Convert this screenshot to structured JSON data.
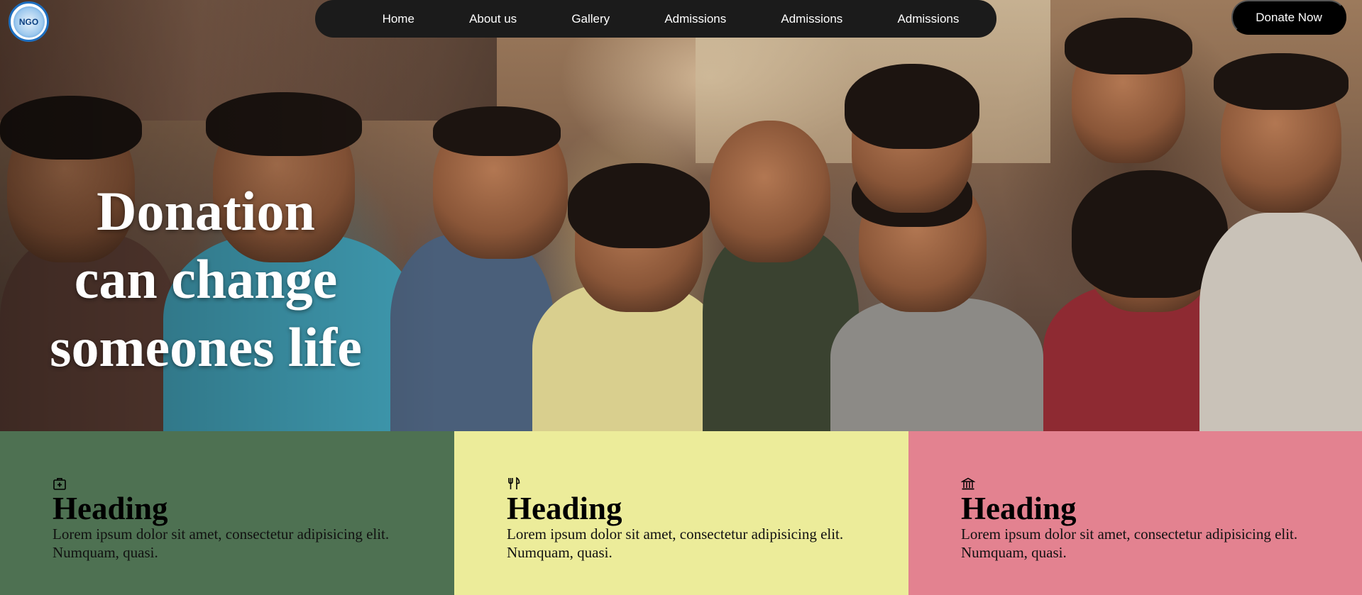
{
  "hero": {
    "title_lines": [
      "Donation",
      "can change",
      "someones life"
    ]
  },
  "logo": {
    "text": "NGO"
  },
  "nav": {
    "items": [
      "Home",
      "About us",
      "Gallery",
      "Admissions",
      "Admissions",
      "Admissions"
    ],
    "donate_label": "Donate Now"
  },
  "cards": [
    {
      "icon": "medical-kit-icon",
      "heading": "Heading",
      "text": "Lorem ipsum dolor sit amet, consectetur adipisicing elit. Numquam, quasi.",
      "color": "#4e7152"
    },
    {
      "icon": "fork-knife-icon",
      "heading": "Heading",
      "text": "Lorem ipsum dolor sit amet, consectetur adipisicing elit. Numquam, quasi.",
      "color": "#ecec9a"
    },
    {
      "icon": "school-building-icon",
      "heading": "Heading",
      "text": "Lorem ipsum dolor sit amet, consectetur adipisicing elit. Numquam, quasi.",
      "color": "#e38290"
    }
  ]
}
